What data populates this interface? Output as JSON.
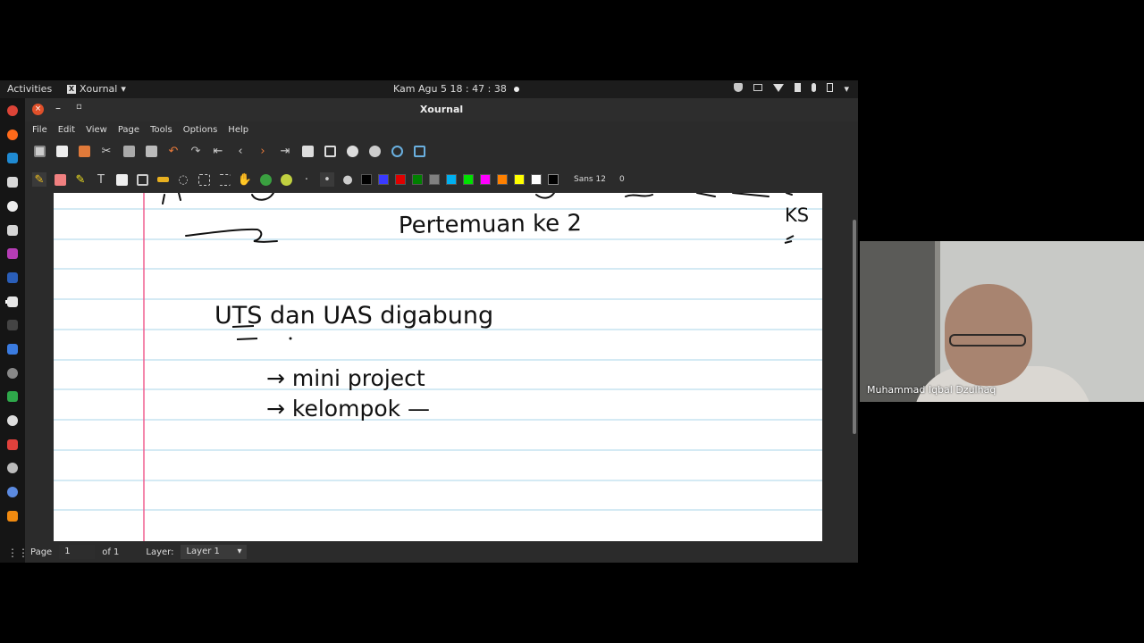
{
  "topbar": {
    "activities": "Activities",
    "app_name": "Xournal",
    "clock": "Kam Agu 5  18 : 47 : 38"
  },
  "window": {
    "title": "Xournal",
    "close_glyph": "×",
    "min_glyph": "–",
    "max_glyph": "▫"
  },
  "menu": [
    "File",
    "Edit",
    "View",
    "Page",
    "Tools",
    "Options",
    "Help"
  ],
  "toolbar2": {
    "font_label": "Sans 12",
    "font_num": "0",
    "colors": [
      "#000000",
      "#3a3aff",
      "#e00000",
      "#008000",
      "#808080",
      "#00b0f0",
      "#00e000",
      "#ff00ff",
      "#ff8000",
      "#ffff00",
      "#ffffff"
    ]
  },
  "statusbar": {
    "page_label": "Page",
    "page_value": "1",
    "of_label": "of 1",
    "layer_label": "Layer:",
    "layer_value": "Layer 1"
  },
  "video": {
    "participant_name": "Muhammad Iqbal Dzulhaq"
  },
  "handwriting": {
    "line1": "Pertemuan ke 2",
    "line2": "UTS dan UAS digabung",
    "line3": "→ mini project",
    "line4": "→ kelompok —",
    "corner": "KS"
  },
  "accent": {
    "close_button": "#e0502a",
    "margin_line": "#f06090",
    "rule_line": "#a9d4e8"
  }
}
